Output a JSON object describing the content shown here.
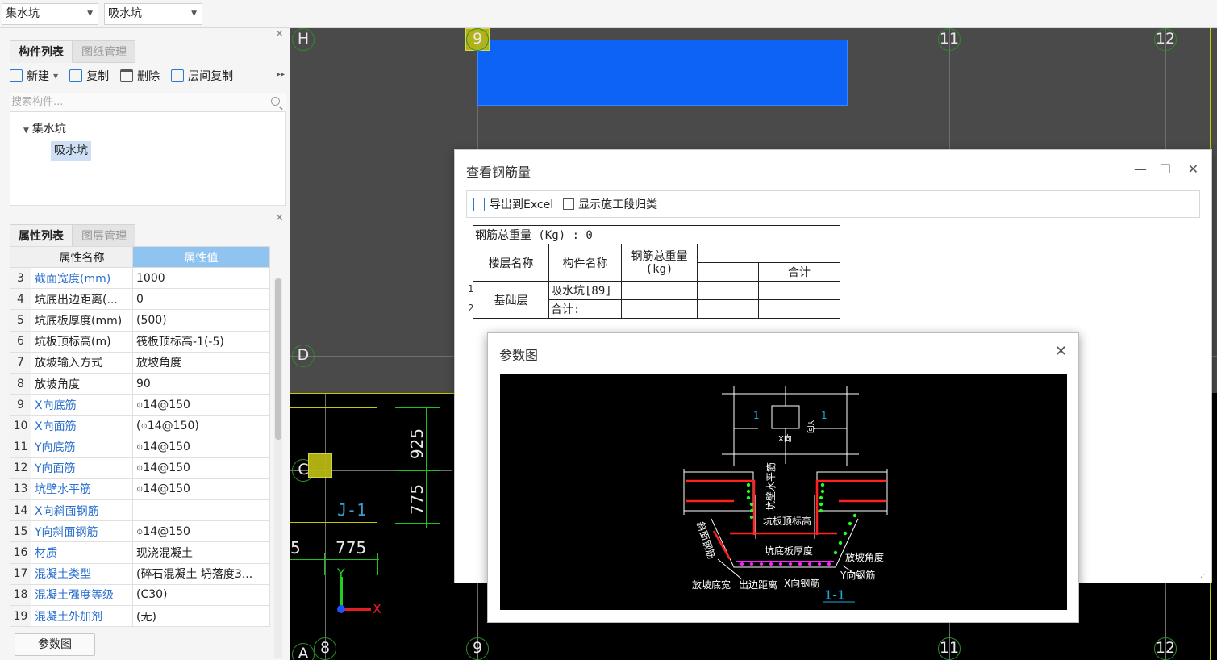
{
  "top_combos": [
    {
      "value": "集水坑"
    },
    {
      "value": "吸水坑"
    }
  ],
  "component_panel": {
    "tabs": [
      "构件列表",
      "图纸管理"
    ],
    "toolbar": {
      "new": "新建",
      "copy": "复制",
      "delete": "删除",
      "floor_copy": "层间复制"
    },
    "search_placeholder": "搜索构件...",
    "tree": {
      "root": "集水坑",
      "child": "吸水坑"
    }
  },
  "property_panel": {
    "tabs": [
      "属性列表",
      "图层管理"
    ],
    "headers": [
      "属性名称",
      "属性值"
    ],
    "rows": [
      {
        "n": "3",
        "name": "截面宽度(mm)",
        "value": "1000",
        "blue": true
      },
      {
        "n": "4",
        "name": "坑底出边距离(...",
        "value": "0",
        "blue": false
      },
      {
        "n": "5",
        "name": "坑底板厚度(mm)",
        "value": "(500)",
        "blue": false
      },
      {
        "n": "6",
        "name": "坑板顶标高(m)",
        "value": "筏板顶标高-1(-5)",
        "blue": false
      },
      {
        "n": "7",
        "name": "放坡输入方式",
        "value": "放坡角度",
        "blue": false
      },
      {
        "n": "8",
        "name": "放坡角度",
        "value": "90",
        "blue": false
      },
      {
        "n": "9",
        "name": "X向底筋",
        "value": "⌽14@150",
        "blue": true
      },
      {
        "n": "10",
        "name": "X向面筋",
        "value": "(⌽14@150)",
        "blue": true
      },
      {
        "n": "11",
        "name": "Y向底筋",
        "value": "⌽14@150",
        "blue": true
      },
      {
        "n": "12",
        "name": "Y向面筋",
        "value": "⌽14@150",
        "blue": true
      },
      {
        "n": "13",
        "name": "坑壁水平筋",
        "value": "⌽14@150",
        "blue": true
      },
      {
        "n": "14",
        "name": "X向斜面钢筋",
        "value": "",
        "blue": true
      },
      {
        "n": "15",
        "name": "Y向斜面钢筋",
        "value": "⌽14@150",
        "blue": true
      },
      {
        "n": "16",
        "name": "材质",
        "value": "现浇混凝土",
        "blue": true
      },
      {
        "n": "17",
        "name": "混凝土类型",
        "value": "(碎石混凝土 坍落度3...",
        "blue": true
      },
      {
        "n": "18",
        "name": "混凝土强度等级",
        "value": "(C30)",
        "blue": true
      },
      {
        "n": "19",
        "name": "混凝土外加剂",
        "value": "(无)",
        "blue": true
      }
    ],
    "param_button": "参数图"
  },
  "canvas": {
    "axis_labels": {
      "H": "H",
      "D": "D",
      "C": "C",
      "A": "A",
      "n8": "8",
      "n9": "9",
      "n11": "11",
      "n12": "12"
    },
    "dims": {
      "d925": "925",
      "d775a": "775",
      "d775b": "775",
      "d5": "5"
    },
    "pit_label": "J-1",
    "axis_x": "X",
    "axis_y": "Y"
  },
  "rebar_dialog": {
    "title": "查看钢筋量",
    "export_label": "导出到Excel",
    "checkbox_label": "显示施工段归类",
    "total_line": "钢筋总重量 (Kg) : 0",
    "col_floor": "楼层名称",
    "col_component": "构件名称",
    "col_weight": "钢筋总重量",
    "col_weight_unit": "(kg)",
    "col_sum": "合计",
    "floor": "基础层",
    "component": "吸水坑[89]",
    "subtotal": "合计:",
    "row1": "1",
    "row2": "2"
  },
  "param_dialog": {
    "title": "参数图",
    "labels": {
      "one_a": "1",
      "one_b": "1",
      "xdir": "X向",
      "ydir": "Y向",
      "wall_hrebar": "坑壁水平筋",
      "top_elev": "坑板顶标高",
      "slope_rebar": "斜面钢筋",
      "bottom_thk": "坑底板厚度",
      "slope_angle": "放坡角度",
      "y_rebar": "Y向钢筋",
      "slope_width": "放坡底宽",
      "edge_dist": "出边距离",
      "x_rebar": "X向钢筋",
      "section": "1-1"
    }
  },
  "colors": {
    "accent_blue": "#2a6fce",
    "canvas_gray": "#4a4a4a",
    "grid_green": "#2e8b2e",
    "plan_blue": "#0d63f5"
  }
}
